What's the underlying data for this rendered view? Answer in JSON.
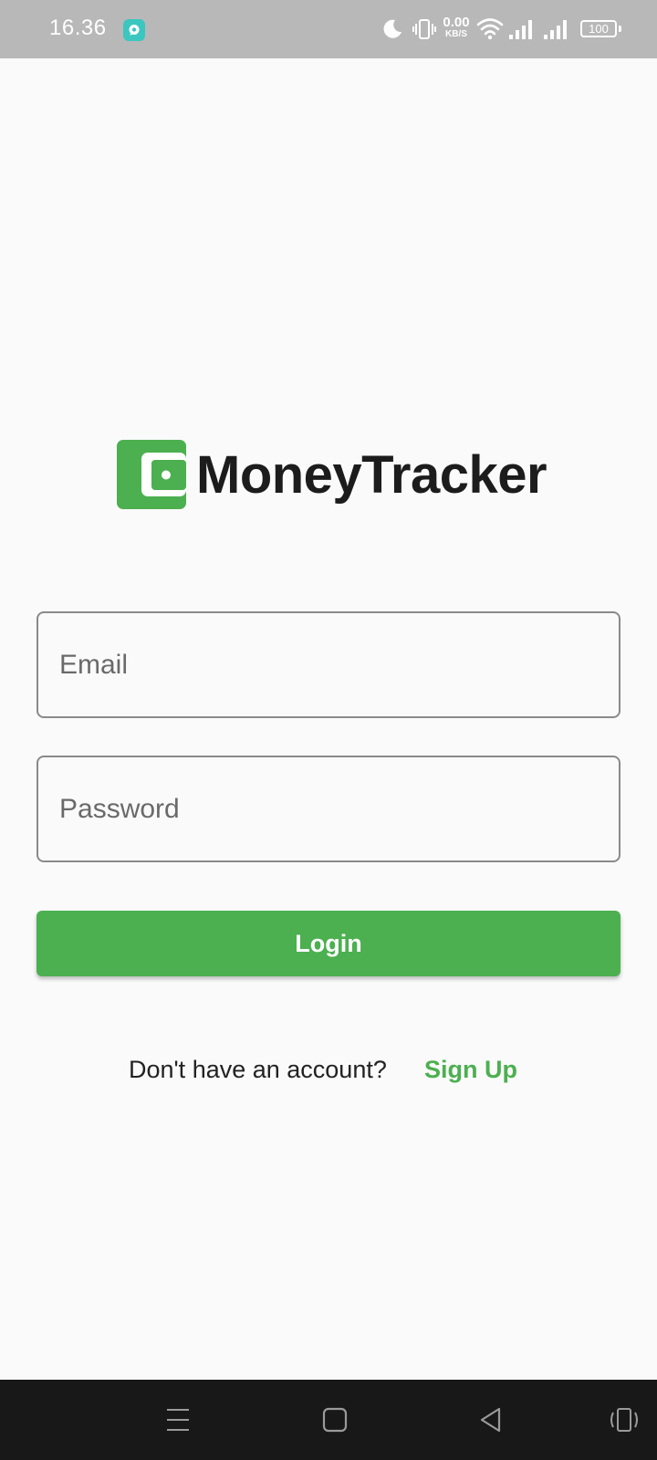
{
  "status_bar": {
    "time": "16.36",
    "net_speed_value": "0.00",
    "net_speed_unit": "KB/S",
    "battery": "100",
    "icons": [
      "notification-app-icon",
      "moon-icon",
      "vibrate-icon",
      "wifi-icon",
      "signal-icon",
      "signal-icon",
      "battery-icon"
    ]
  },
  "app": {
    "name": "MoneyTracker",
    "logo_icon": "wallet-icon",
    "brand_color": "#4caf50"
  },
  "form": {
    "email_placeholder": "Email",
    "password_placeholder": "Password",
    "login_label": "Login"
  },
  "signup": {
    "prompt": "Don't have an account?",
    "link_label": "Sign Up"
  },
  "nav_bar": {
    "icons": [
      "menu-icon",
      "home-icon",
      "back-icon",
      "rotate-icon"
    ]
  }
}
